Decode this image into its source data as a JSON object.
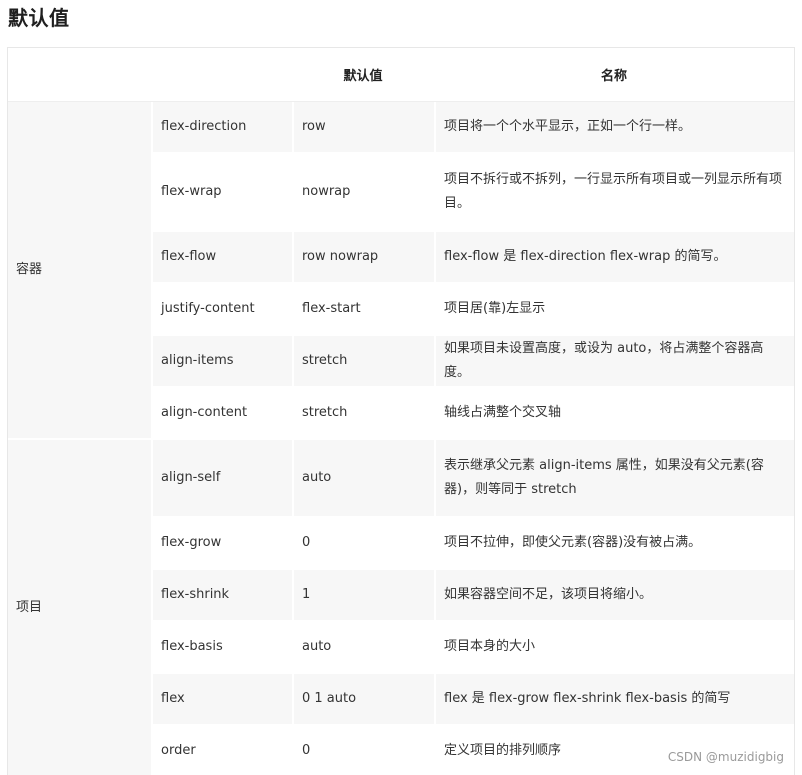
{
  "heading": "默认值",
  "table": {
    "headers": [
      "",
      "",
      "默认值",
      "名称"
    ],
    "groups": [
      {
        "label": "容器",
        "rows": [
          {
            "property": "flex-direction",
            "default": "row",
            "description": "项目将一个个水平显示，正如一个行一样。"
          },
          {
            "property": "flex-wrap",
            "default": "nowrap",
            "description": "项目不拆行或不拆列，一行显示所有项目或一列显示所有项目。"
          },
          {
            "property": "flex-flow",
            "default": "row nowrap",
            "description": "flex-flow 是 flex-direction flex-wrap 的简写。"
          },
          {
            "property": "justify-content",
            "default": "flex-start",
            "description": "项目居(靠)左显示"
          },
          {
            "property": "align-items",
            "default": "stretch",
            "description": "如果项目未设置高度，或设为 auto，将占满整个容器高度。"
          },
          {
            "property": "align-content",
            "default": "stretch",
            "description": "轴线占满整个交叉轴"
          }
        ]
      },
      {
        "label": "项目",
        "rows": [
          {
            "property": "align-self",
            "default": "auto",
            "description": "表示继承父元素 align-items 属性，如果没有父元素(容器)，则等同于 stretch"
          },
          {
            "property": "flex-grow",
            "default": "0",
            "description": "项目不拉伸，即使父元素(容器)没有被占满。"
          },
          {
            "property": "flex-shrink",
            "default": "1",
            "description": "如果容器空间不足，该项目将缩小。"
          },
          {
            "property": "flex-basis",
            "default": "auto",
            "description": "项目本身的大小"
          },
          {
            "property": "flex",
            "default": "0 1 auto",
            "description": "flex 是 flex-grow flex-shrink flex-basis 的简写"
          },
          {
            "property": "order",
            "default": "0",
            "description": "定义项目的排列顺序"
          }
        ]
      }
    ]
  },
  "watermark": "CSDN @muzidigbig"
}
